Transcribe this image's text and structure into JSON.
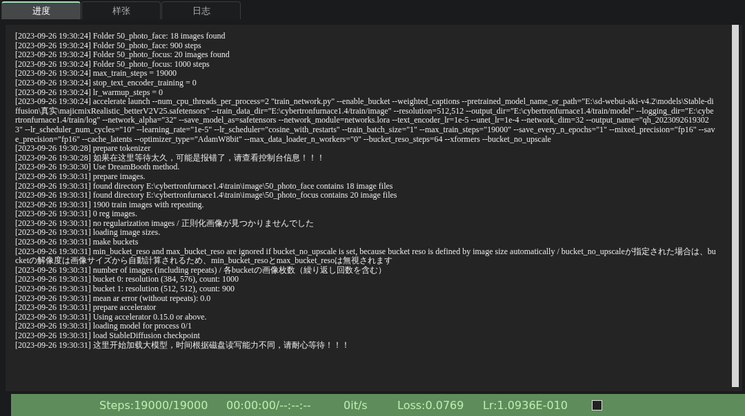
{
  "tabs": [
    {
      "label": "进度",
      "selected": true
    },
    {
      "label": "样张",
      "selected": false
    },
    {
      "label": "日志",
      "selected": false
    }
  ],
  "log": [
    "[2023-09-26 19:30:24] Folder 50_photo_face: 18 images found",
    "[2023-09-26 19:30:24] Folder 50_photo_face: 900 steps",
    "[2023-09-26 19:30:24] Folder 50_photo_focus: 20 images found",
    "[2023-09-26 19:30:24] Folder 50_photo_focus: 1000 steps",
    "[2023-09-26 19:30:24] max_train_steps = 19000",
    "[2023-09-26 19:30:24] stop_text_encoder_training = 0",
    "[2023-09-26 19:30:24] lr_warmup_steps = 0",
    "[2023-09-26 19:30:24] accelerate launch --num_cpu_threads_per_process=2 \"train_network.py\" --enable_bucket --weighted_captions --pretrained_model_name_or_path=\"E:\\sd-webui-aki-v4.2\\models\\Stable-diffusion\\真实\\majicmixRealistic_betterV2V25.safetensors\" --train_data_dir=\"E:\\cybertronfurnace1.4/train/image\" --resolution=512,512 --output_dir=\"E:\\cybertronfurnace1.4/train/model\" --logging_dir=\"E:\\cybertronfurnace1.4/train/log\" --network_alpha=\"32\" --save_model_as=safetensors --network_module=networks.lora --text_encoder_lr=1e-5 --unet_lr=1e-4 --network_dim=32 --output_name=\"qh_20230926193023\" --lr_scheduler_num_cycles=\"10\" --learning_rate=\"1e-5\" --lr_scheduler=\"cosine_with_restarts\" --train_batch_size=\"1\" --max_train_steps=\"19000\" --save_every_n_epochs=\"1\" --mixed_precision=\"fp16\" --save_precision=\"fp16\" --cache_latents --optimizer_type=\"AdamW8bit\" --max_data_loader_n_workers=\"0\" --bucket_reso_steps=64 --xformers --bucket_no_upscale",
    "[2023-09-26 19:30:28] prepare tokenizer",
    "[2023-09-26 19:30:28] 如果在这里等待太久，可能是报错了，请查看控制台信息！！！",
    "[2023-09-26 19:30:30] Use DreamBooth method.",
    "[2023-09-26 19:30:31] prepare images.",
    "[2023-09-26 19:30:31] found directory E:\\cybertronfurnace1.4\\train\\image\\50_photo_face contains 18 image files",
    "[2023-09-26 19:30:31] found directory E:\\cybertronfurnace1.4\\train\\image\\50_photo_focus contains 20 image files",
    "[2023-09-26 19:30:31] 1900 train images with repeating.",
    "[2023-09-26 19:30:31] 0 reg images.",
    "[2023-09-26 19:30:31] no regularization images / 正則化画像が見つかりませんでした",
    "[2023-09-26 19:30:31] loading image sizes.",
    "[2023-09-26 19:30:31] make buckets",
    "[2023-09-26 19:30:31] min_bucket_reso and max_bucket_reso are ignored if bucket_no_upscale is set, because bucket reso is defined by image size automatically / bucket_no_upscaleが指定された場合は、bucketの解像度は画像サイズから自動計算されるため、min_bucket_resoとmax_bucket_resoは無視されます",
    "[2023-09-26 19:30:31] number of images (including repeats) / 各bucketの画像枚数（繰り返し回数を含む）",
    "[2023-09-26 19:30:31] bucket 0: resolution (384, 576), count: 1000",
    "[2023-09-26 19:30:31] bucket 1: resolution (512, 512), count: 900",
    "[2023-09-26 19:30:31] mean ar error (without repeats): 0.0",
    "[2023-09-26 19:30:31] prepare accelerator",
    "[2023-09-26 19:30:31] Using accelerator 0.15.0 or above.",
    "[2023-09-26 19:30:31] loading model for process 0/1",
    "[2023-09-26 19:30:31] load StableDiffusion checkpoint",
    "[2023-09-26 19:30:31] 这里开始加载大模型，时间根据磁盘读写能力不同，请耐心等待！！！"
  ],
  "status": {
    "steps": "Steps:19000/19000",
    "time": "00:00:00/--:--:--",
    "speed": "0it/s",
    "loss": "Loss:0.0769",
    "lr": "Lr:1.0936E-010",
    "checked": false
  }
}
